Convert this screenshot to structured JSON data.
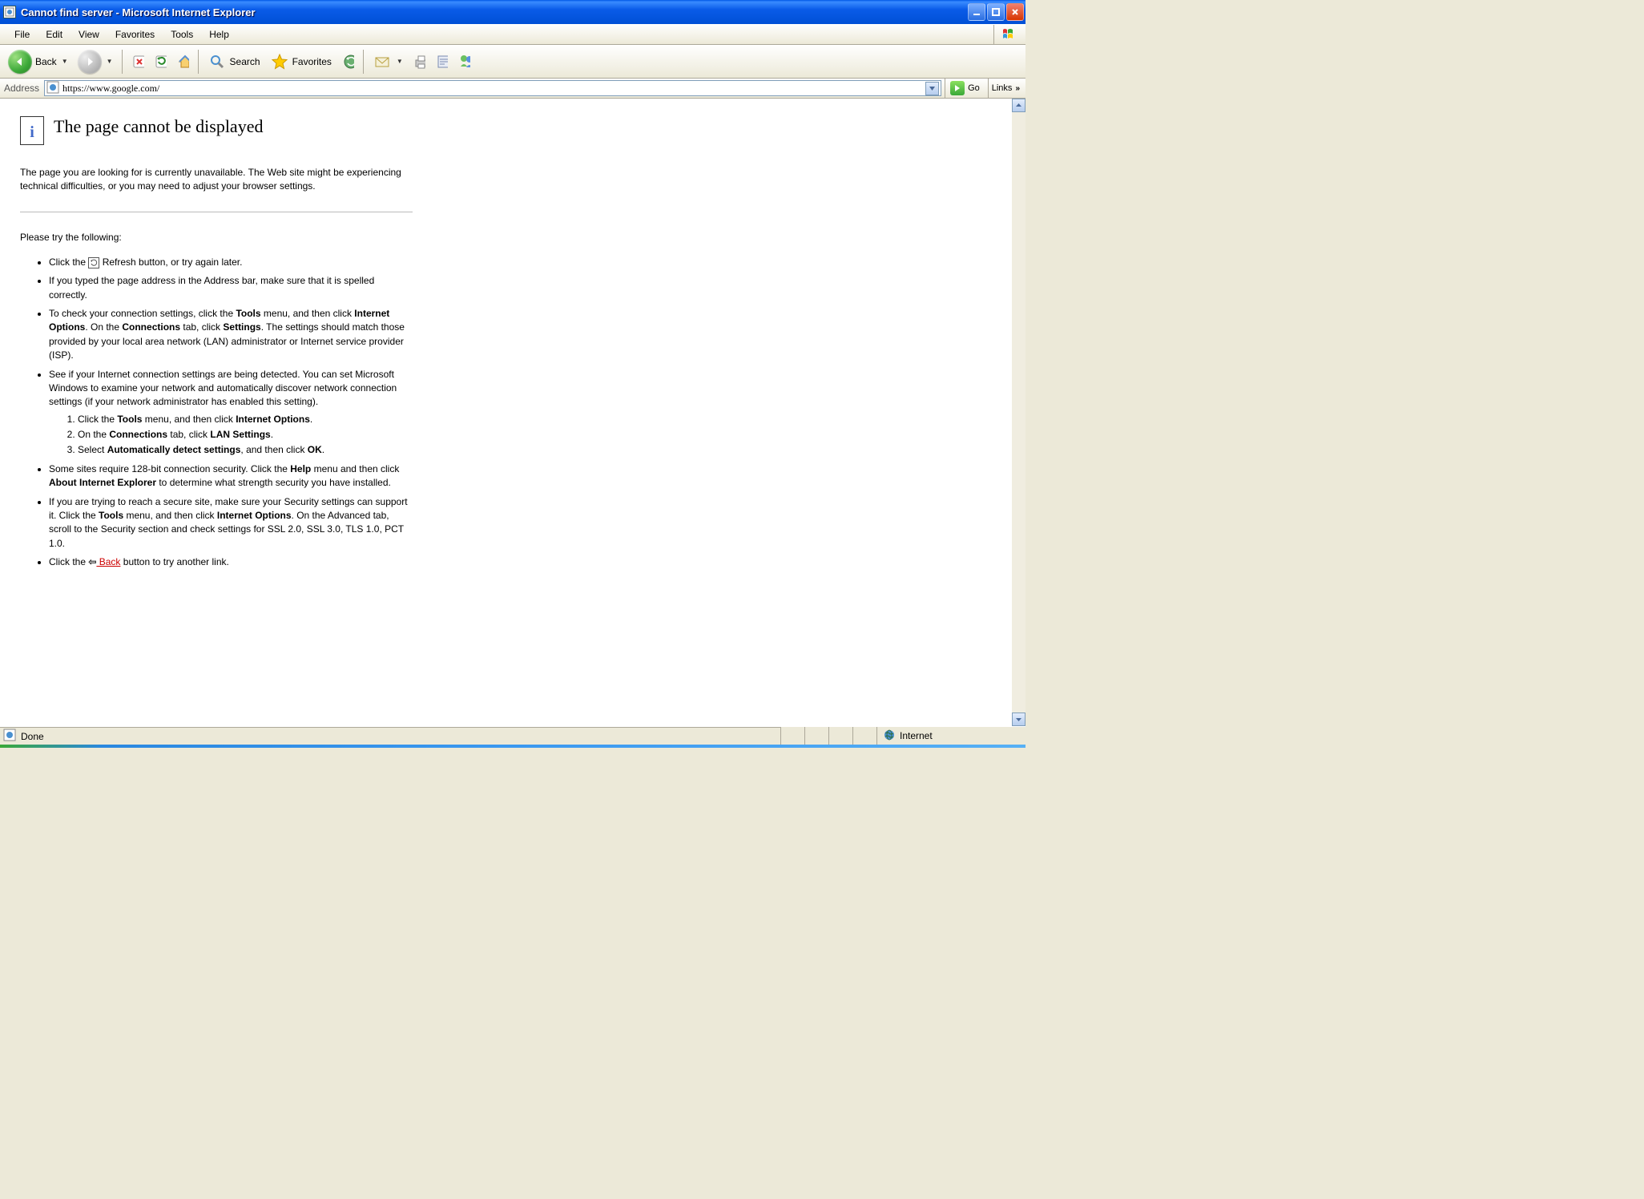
{
  "window": {
    "title": "Cannot find server - Microsoft Internet Explorer"
  },
  "menubar": [
    "File",
    "Edit",
    "View",
    "Favorites",
    "Tools",
    "Help"
  ],
  "toolbar": {
    "back": "Back",
    "search": "Search",
    "favorites": "Favorites"
  },
  "addressbar": {
    "label": "Address",
    "url": "https://www.google.com/",
    "go": "Go",
    "links": "Links"
  },
  "error": {
    "title": "The page cannot be displayed",
    "intro": "The page you are looking for is currently unavailable. The Web site might be experiencing technical difficulties, or you may need to adjust your browser settings.",
    "try_label": "Please try the following:",
    "b1_a": "Click the ",
    "b1_b": " Refresh button, or try again later.",
    "b2": "If you typed the page address in the Address bar, make sure that it is spelled correctly.",
    "b3_a": "To check your connection settings, click the ",
    "b3_tools": "Tools",
    "b3_b": " menu, and then click ",
    "b3_io": "Internet Options",
    "b3_c": ". On the ",
    "b3_conn": "Connections",
    "b3_d": " tab, click ",
    "b3_set": "Settings",
    "b3_e": ". The settings should match those provided by your local area network (LAN) administrator or Internet service provider (ISP).",
    "b4": "See if your Internet connection settings are being detected. You can set Microsoft Windows to examine your network and automatically discover network connection settings (if your network administrator has enabled this setting).",
    "s1_a": "Click the ",
    "s1_tools": "Tools",
    "s1_b": " menu, and then click ",
    "s1_io": "Internet Options",
    "s1_c": ".",
    "s2_a": "On the ",
    "s2_conn": "Connections",
    "s2_b": " tab, click ",
    "s2_lan": "LAN Settings",
    "s2_c": ".",
    "s3_a": "Select ",
    "s3_auto": "Automatically detect settings",
    "s3_b": ", and then click ",
    "s3_ok": "OK",
    "s3_c": ".",
    "b5_a": "Some sites require 128-bit connection security. Click the ",
    "b5_help": "Help",
    "b5_b": " menu and then click ",
    "b5_about": "About Internet Explorer",
    "b5_c": " to determine what strength security you have installed.",
    "b6_a": "If you are trying to reach a secure site, make sure your Security settings can support it. Click the ",
    "b6_tools": "Tools",
    "b6_b": " menu, and then click ",
    "b6_io": "Internet Options",
    "b6_c": ". On the Advanced tab, scroll to the Security section and check settings for SSL 2.0, SSL 3.0, TLS 1.0, PCT 1.0.",
    "b7_a": "Click the ",
    "b7_back": " Back",
    "b7_b": " button to try another link."
  },
  "statusbar": {
    "done": "Done",
    "zone": "Internet"
  }
}
